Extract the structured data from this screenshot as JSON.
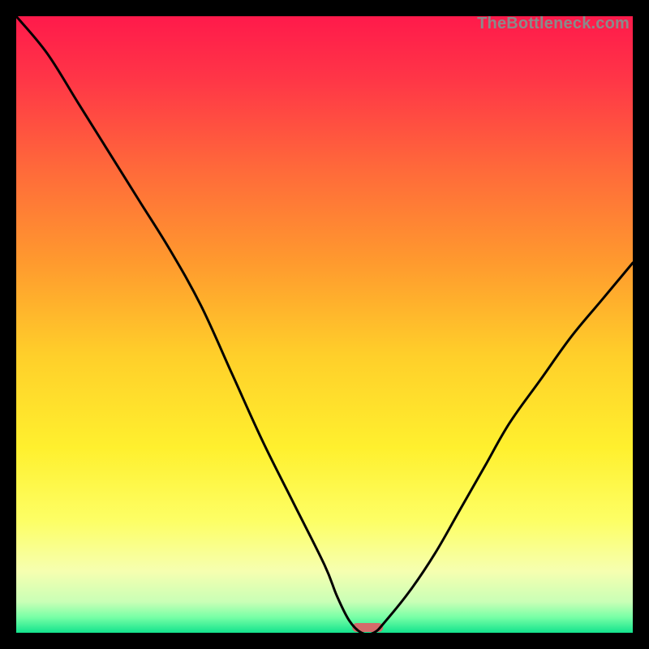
{
  "watermark": "TheBottleneck.com",
  "chart_data": {
    "type": "line",
    "title": "",
    "xlabel": "",
    "ylabel": "",
    "xlim": [
      0,
      100
    ],
    "ylim": [
      0,
      100
    ],
    "grid": false,
    "gradient_stops": [
      {
        "offset": 0.0,
        "color": "#ff1a4b"
      },
      {
        "offset": 0.1,
        "color": "#ff3547"
      },
      {
        "offset": 0.25,
        "color": "#ff6a3a"
      },
      {
        "offset": 0.4,
        "color": "#ff9a2e"
      },
      {
        "offset": 0.55,
        "color": "#ffcf2a"
      },
      {
        "offset": 0.7,
        "color": "#fff02e"
      },
      {
        "offset": 0.82,
        "color": "#fdff66"
      },
      {
        "offset": 0.9,
        "color": "#f6ffb0"
      },
      {
        "offset": 0.95,
        "color": "#c9ffb6"
      },
      {
        "offset": 0.975,
        "color": "#77ffa6"
      },
      {
        "offset": 1.0,
        "color": "#13e38d"
      }
    ],
    "series": [
      {
        "name": "bottleneck-curve",
        "x": [
          0,
          5,
          10,
          15,
          20,
          25,
          30,
          35,
          40,
          45,
          50,
          52,
          54,
          56,
          58,
          60,
          64,
          68,
          72,
          76,
          80,
          85,
          90,
          95,
          100
        ],
        "values": [
          100,
          94,
          86,
          78,
          70,
          62,
          53,
          42,
          31,
          21,
          11,
          6,
          2,
          0,
          0,
          2,
          7,
          13,
          20,
          27,
          34,
          41,
          48,
          54,
          60
        ]
      }
    ],
    "marker": {
      "x": 57,
      "width_pct": 5,
      "color": "#d46a6a"
    }
  }
}
